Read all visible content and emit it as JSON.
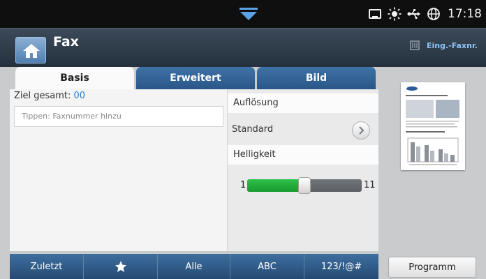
{
  "status": {
    "time": "17:18"
  },
  "header": {
    "title": "Fax",
    "incoming_label": "Eing.-Faxnr."
  },
  "tabs": [
    {
      "label": "Basis",
      "active": true
    },
    {
      "label": "Erweitert",
      "active": false
    },
    {
      "label": "Bild",
      "active": false
    }
  ],
  "recipients": {
    "label": "Ziel gesamt:",
    "count": "00",
    "input_placeholder": "Tippen: Faxnummer hinzu"
  },
  "settings": {
    "resolution_label": "Auflösung",
    "resolution_value": "Standard",
    "brightness_label": "Helligkeit",
    "brightness_min": "1",
    "brightness_max": "11",
    "brightness_value": 6
  },
  "bottom_bar": {
    "items": [
      {
        "label": "Zuletzt",
        "icon": null
      },
      {
        "label": "",
        "icon": "star-icon"
      },
      {
        "label": "Alle",
        "icon": null
      },
      {
        "label": "ABC",
        "icon": null
      },
      {
        "label": "123/!@#",
        "icon": null
      }
    ],
    "program_label": "Programm"
  },
  "colors": {
    "accent_blue": "#2f5f93",
    "count_blue": "#2d7bc9",
    "slider_green": "#1fae3a",
    "incoming_blue": "#8fc3f5"
  }
}
